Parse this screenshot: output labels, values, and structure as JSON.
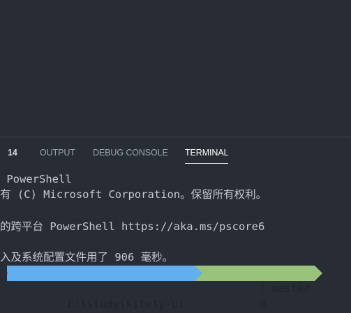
{
  "tabs": {
    "badge": "14",
    "output": "OUTPUT",
    "debug_console": "DEBUG CONSOLE",
    "terminal": "TERMINAL"
  },
  "terminal": {
    "lines": [
      " PowerShell",
      "有 (C) Microsoft Corporation。保留所有权利。",
      "",
      "的跨平台 PowerShell https://aka.ms/pscore6",
      "",
      "入及系统配置文件用了 906 毫秒。"
    ],
    "prompt": {
      "path": "E:\\study\\kitety-ui",
      "branch_icon": "git-branch-icon",
      "branch_glyph": "ᚴ",
      "branch": "master",
      "status_glyph": "≣"
    }
  },
  "colors": {
    "background": "#282c34",
    "path_segment": "#61afef",
    "git_segment": "#98c379",
    "text": "#c5c9d0"
  }
}
